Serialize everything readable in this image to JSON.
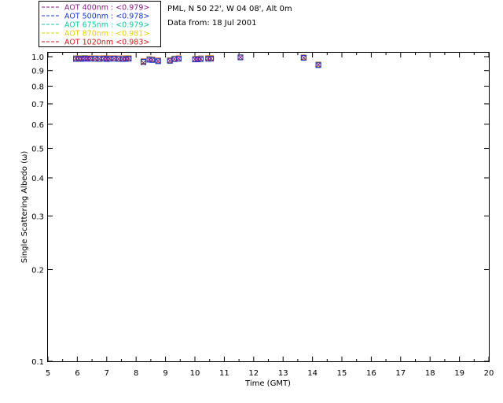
{
  "info": {
    "site": "PML, N 50 22', W 04 08', Alt 0m",
    "date": "Data from: 18 Jul 2001"
  },
  "chart_data": {
    "type": "scatter",
    "xlabel": "Time (GMT)",
    "ylabel": "Single Scattering Albedo (ω)",
    "xlim": [
      5,
      20
    ],
    "ylim": [
      0.1,
      1.0
    ],
    "yscale": "log",
    "xticks": [
      "5",
      "6",
      "7",
      "8",
      "9",
      "10",
      "11",
      "12",
      "13",
      "14",
      "15",
      "16",
      "17",
      "18",
      "19",
      "20"
    ],
    "yticks": [
      {
        "v": 1.0,
        "label": "1.0"
      },
      {
        "v": 0.9,
        "label": "0.9"
      },
      {
        "v": 0.8,
        "label": "0.8"
      },
      {
        "v": 0.7,
        "label": "0.7"
      },
      {
        "v": 0.6,
        "label": "0.6"
      },
      {
        "v": 0.5,
        "label": "0.5"
      },
      {
        "v": 0.4,
        "label": "0.4"
      },
      {
        "v": 0.3,
        "label": "0.3"
      },
      {
        "v": 0.2,
        "label": "0.2"
      },
      {
        "v": 0.1,
        "label": "0.1"
      }
    ],
    "grid": false,
    "legend_position": "top-left, outside plot",
    "x": [
      5.95,
      6.05,
      6.15,
      6.25,
      6.35,
      6.45,
      6.6,
      6.75,
      6.9,
      7.0,
      7.1,
      7.25,
      7.4,
      7.55,
      7.65,
      7.75,
      8.25,
      8.45,
      8.55,
      8.75,
      9.15,
      9.3,
      9.45,
      10.0,
      10.1,
      10.2,
      10.45,
      10.55,
      11.55,
      13.7,
      14.2
    ],
    "series": [
      {
        "name": "AOT  400nm",
        "mean_label": ": <0.979>",
        "color": "#8b1a8b",
        "values": [
          0.985,
          0.986,
          0.984,
          0.987,
          0.985,
          0.986,
          0.985,
          0.984,
          0.986,
          0.983,
          0.985,
          0.986,
          0.984,
          0.983,
          0.984,
          0.986,
          0.955,
          0.978,
          0.976,
          0.968,
          0.97,
          0.982,
          0.985,
          0.98,
          0.981,
          0.983,
          0.985,
          0.986,
          0.995,
          0.992,
          0.94
        ]
      },
      {
        "name": "AOT  500nm",
        "mean_label": ": <0.978>",
        "color": "#1438c8",
        "values": [
          0.983,
          0.985,
          0.983,
          0.986,
          0.984,
          0.985,
          0.984,
          0.983,
          0.985,
          0.982,
          0.984,
          0.985,
          0.983,
          0.982,
          0.983,
          0.985,
          0.962,
          0.977,
          0.975,
          0.966,
          0.969,
          0.981,
          0.984,
          0.979,
          0.98,
          0.982,
          0.984,
          0.985,
          0.994,
          0.991,
          0.938
        ]
      },
      {
        "name": "AOT  675nm",
        "mean_label": ": <0.979>",
        "color": "#11c8a0",
        "values": [
          0.984,
          0.986,
          0.984,
          0.987,
          0.985,
          0.986,
          0.985,
          0.984,
          0.986,
          0.983,
          0.985,
          0.986,
          0.984,
          0.983,
          0.984,
          0.986,
          0.96,
          0.978,
          0.976,
          0.967,
          0.97,
          0.982,
          0.985,
          0.98,
          0.981,
          0.983,
          0.985,
          0.986,
          0.995,
          0.992,
          0.939
        ]
      },
      {
        "name": "AOT  870nm",
        "mean_label": ": <0.981>",
        "color": "#e6d000",
        "values": [
          0.986,
          0.987,
          0.985,
          0.988,
          0.986,
          0.987,
          0.986,
          0.985,
          0.987,
          0.985,
          0.986,
          0.987,
          0.985,
          0.985,
          0.986,
          0.987,
          0.963,
          0.98,
          0.978,
          0.969,
          0.972,
          0.984,
          0.986,
          0.982,
          0.983,
          0.985,
          0.987,
          0.988,
          0.996,
          0.993,
          0.941
        ]
      },
      {
        "name": "AOT 1020nm",
        "mean_label": ": <0.983>",
        "color": "#d01818",
        "values": [
          0.988,
          0.989,
          0.987,
          0.99,
          0.988,
          0.989,
          0.988,
          0.987,
          0.989,
          0.987,
          0.988,
          0.989,
          0.987,
          0.987,
          0.988,
          0.989,
          0.966,
          0.982,
          0.98,
          0.972,
          0.974,
          0.986,
          0.988,
          0.984,
          0.985,
          0.987,
          0.989,
          0.99,
          0.997,
          0.995,
          0.943
        ]
      }
    ]
  }
}
